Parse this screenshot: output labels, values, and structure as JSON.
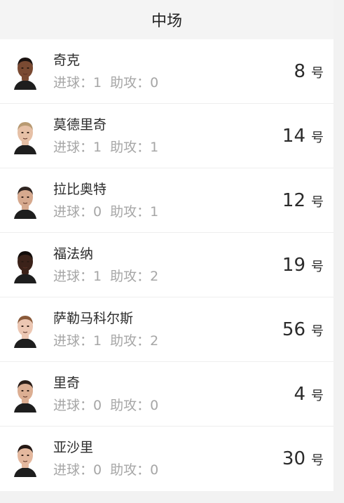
{
  "header": {
    "title": "中场"
  },
  "labels": {
    "goals": "进球：",
    "assists": "助攻：",
    "number_unit": "号"
  },
  "players": [
    {
      "name": "奇克",
      "goals": "1",
      "assists": "0",
      "number": "8",
      "skin": "#7a4a32",
      "hair": "#1a1210"
    },
    {
      "name": "莫德里奇",
      "goals": "1",
      "assists": "1",
      "number": "14",
      "skin": "#e6c0a6",
      "hair": "#b89a72"
    },
    {
      "name": "拉比奥特",
      "goals": "0",
      "assists": "1",
      "number": "12",
      "skin": "#d6a98e",
      "hair": "#2e2420"
    },
    {
      "name": "福法纳",
      "goals": "1",
      "assists": "2",
      "number": "19",
      "skin": "#3b2219",
      "hair": "#120c0a"
    },
    {
      "name": "萨勒马科尔斯",
      "goals": "1",
      "assists": "2",
      "number": "56",
      "skin": "#ecc7b3",
      "hair": "#8a5a3a"
    },
    {
      "name": "里奇",
      "goals": "0",
      "assists": "0",
      "number": "4",
      "skin": "#dcae92",
      "hair": "#2a1d17"
    },
    {
      "name": "亚沙里",
      "goals": "0",
      "assists": "0",
      "number": "30",
      "skin": "#e4b89e",
      "hair": "#241814"
    }
  ]
}
